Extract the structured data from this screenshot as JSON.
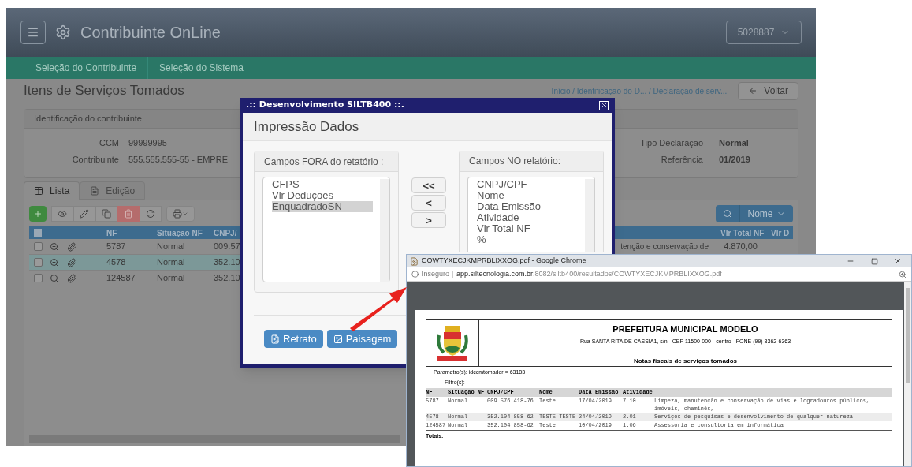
{
  "app": {
    "title": "Contribuinte OnLine",
    "user_menu": "5028887",
    "nav": [
      "Seleção do Contribuinte",
      "Seleção do Sistema"
    ],
    "page_title": "Itens de Serviços Tomados",
    "breadcrumb": "Início / Identificação do D... / Declaração de serv...",
    "back_button": "Voltar",
    "taxpayer_card": {
      "title": "Identificação do contribuinte",
      "left_fields": [
        {
          "label": "CCM",
          "value": "99999995"
        },
        {
          "label": "Contribuinte",
          "value": "555.555.555-55 - EMPRE"
        }
      ],
      "right_fields": [
        {
          "label": "Tipo Declaração",
          "value": "Normal"
        },
        {
          "label": "Referência",
          "value": "01/2019"
        }
      ]
    },
    "tabs": [
      {
        "label": "Lista",
        "selected": true
      },
      {
        "label": "Edição",
        "selected": false
      }
    ],
    "search_menu": "Nome",
    "table": {
      "select_all_checked": false,
      "left_columns": [
        "NF",
        "Situação NF",
        "CNPJ/"
      ],
      "right_columns": [
        "Vlr Total NF",
        "Vlr D"
      ],
      "rows": [
        {
          "nf": "5787",
          "status": "Normal",
          "cnpj": "009.57",
          "description": "tenção e conservação de",
          "total": "4.870,00",
          "checked": false,
          "selected": false
        },
        {
          "nf": "4578",
          "status": "Normal",
          "cnpj": "352.10",
          "checked": false,
          "selected": true
        },
        {
          "nf": "124587",
          "status": "Normal",
          "cnpj": "352.10",
          "checked": false,
          "selected": false
        }
      ]
    }
  },
  "dialog": {
    "title": ".:: Desenvolvimento SILTB400 ::.",
    "heading": "Impressão Dados",
    "available": {
      "title": "Campos FORA do retatório :",
      "items": [
        {
          "label": "CFPS",
          "selected": false
        },
        {
          "label": "Vlr Deduções",
          "selected": false
        },
        {
          "label": "EnquadradoSN",
          "selected": true
        }
      ]
    },
    "move_buttons": [
      "<<",
      "<",
      ">"
    ],
    "included": {
      "title": "Campos NO relatório:",
      "items": [
        {
          "label": "CNPJ/CPF",
          "selected": false
        },
        {
          "label": "Nome",
          "selected": false
        },
        {
          "label": "Data Emissão",
          "selected": false
        },
        {
          "label": "Atividade",
          "selected": false
        },
        {
          "label": "Vlr Total NF",
          "selected": false
        },
        {
          "label": "%",
          "selected": false
        }
      ]
    },
    "buttons": [
      {
        "kind": "portrait",
        "label": "Retrato"
      },
      {
        "kind": "landscape",
        "label": "Paisagem"
      }
    ]
  },
  "browser": {
    "title": "COWTYXECJKMPRBLIXXOG.pdf - Google Chrome",
    "security": "Inseguro",
    "url_host": "app.siltecnologia.com.br",
    "url_rest": ":8082/siltb400/resultados/COWTYXECJKMPRBLIXXOG.pdf",
    "report": {
      "title": "PREFEITURA MUNICIPAL MODELO",
      "address": "Rua SANTA RITA DE CASSIA1, s/n - CEP 11500-000 - centro - FONE (99) 3362-6363",
      "subtitle": "Notas fiscais de serviços tomados",
      "parameters": "Parametro(s): idccmtomador = 63183",
      "filters": "Filtro(s):",
      "columns": [
        "NF",
        "Situação NF",
        "CNPJ/CPF",
        "Nome",
        "Data Emissão",
        "Atividade"
      ],
      "rows": [
        [
          "5787",
          "Normal",
          "009.576.418-76",
          "Teste",
          "17/04/2019",
          "7.10",
          "Limpeza, manutenção e conservação de vias e logradouros públicos, imóveis, chaminés,"
        ],
        [
          "4578",
          "Normal",
          "352.104.858-62",
          "TESTE TESTE",
          "24/04/2019",
          "2.01",
          "Serviços de pesquisas e desenvolvimento de qualquer natureza"
        ],
        [
          "124587",
          "Normal",
          "352.104.858-62",
          "Teste",
          "10/04/2019",
          "1.06",
          "Assessoria e consultoria em informática"
        ]
      ],
      "totals": "Totais:"
    }
  }
}
